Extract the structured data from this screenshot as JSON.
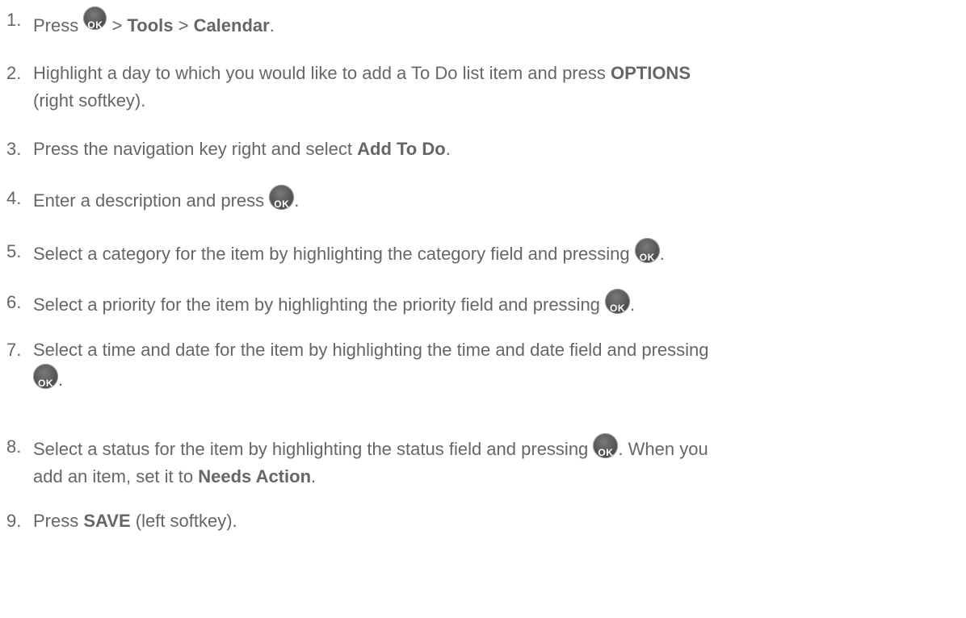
{
  "steps": [
    {
      "num": "1.",
      "parts": [
        "Press",
        "OK",
        " > ",
        "Tools",
        " > ",
        "Calendar",
        "."
      ]
    },
    {
      "num": "2.",
      "line1": "Highlight a day to which you would like to add a To Do list item and press ",
      "bold1": "OPTIONS",
      "line2": "(right softkey)."
    },
    {
      "num": "3.",
      "text": "Press the navigation key right and select ",
      "bold": "Add To Do",
      "end": "."
    },
    {
      "num": "4.",
      "text": "Enter a description and press ",
      "end": "."
    },
    {
      "num": "5.",
      "text": "Select a category for the item by highlighting the category field and pressing ",
      "end": "."
    },
    {
      "num": "6.",
      "text": "Select a priority for the item by highlighting the priority field and pressing ",
      "end": "."
    },
    {
      "num": "7.",
      "text": "Select a time and date for the item by highlighting the time and date field and pressing",
      "end": "."
    },
    {
      "num": "8.",
      "text": "Select a status for the item by highlighting the status field and pressing ",
      "after": ". When you",
      "line2": "add an item, set it to ",
      "bold": "Needs Action",
      "end": "."
    },
    {
      "num": "9.",
      "text": "Press ",
      "bold": "SAVE",
      "after": " (left softkey)."
    }
  ],
  "icons": {
    "ok_key": "ok-key-icon"
  },
  "colors": {
    "text": "#666666",
    "ok_key": "#555555"
  }
}
